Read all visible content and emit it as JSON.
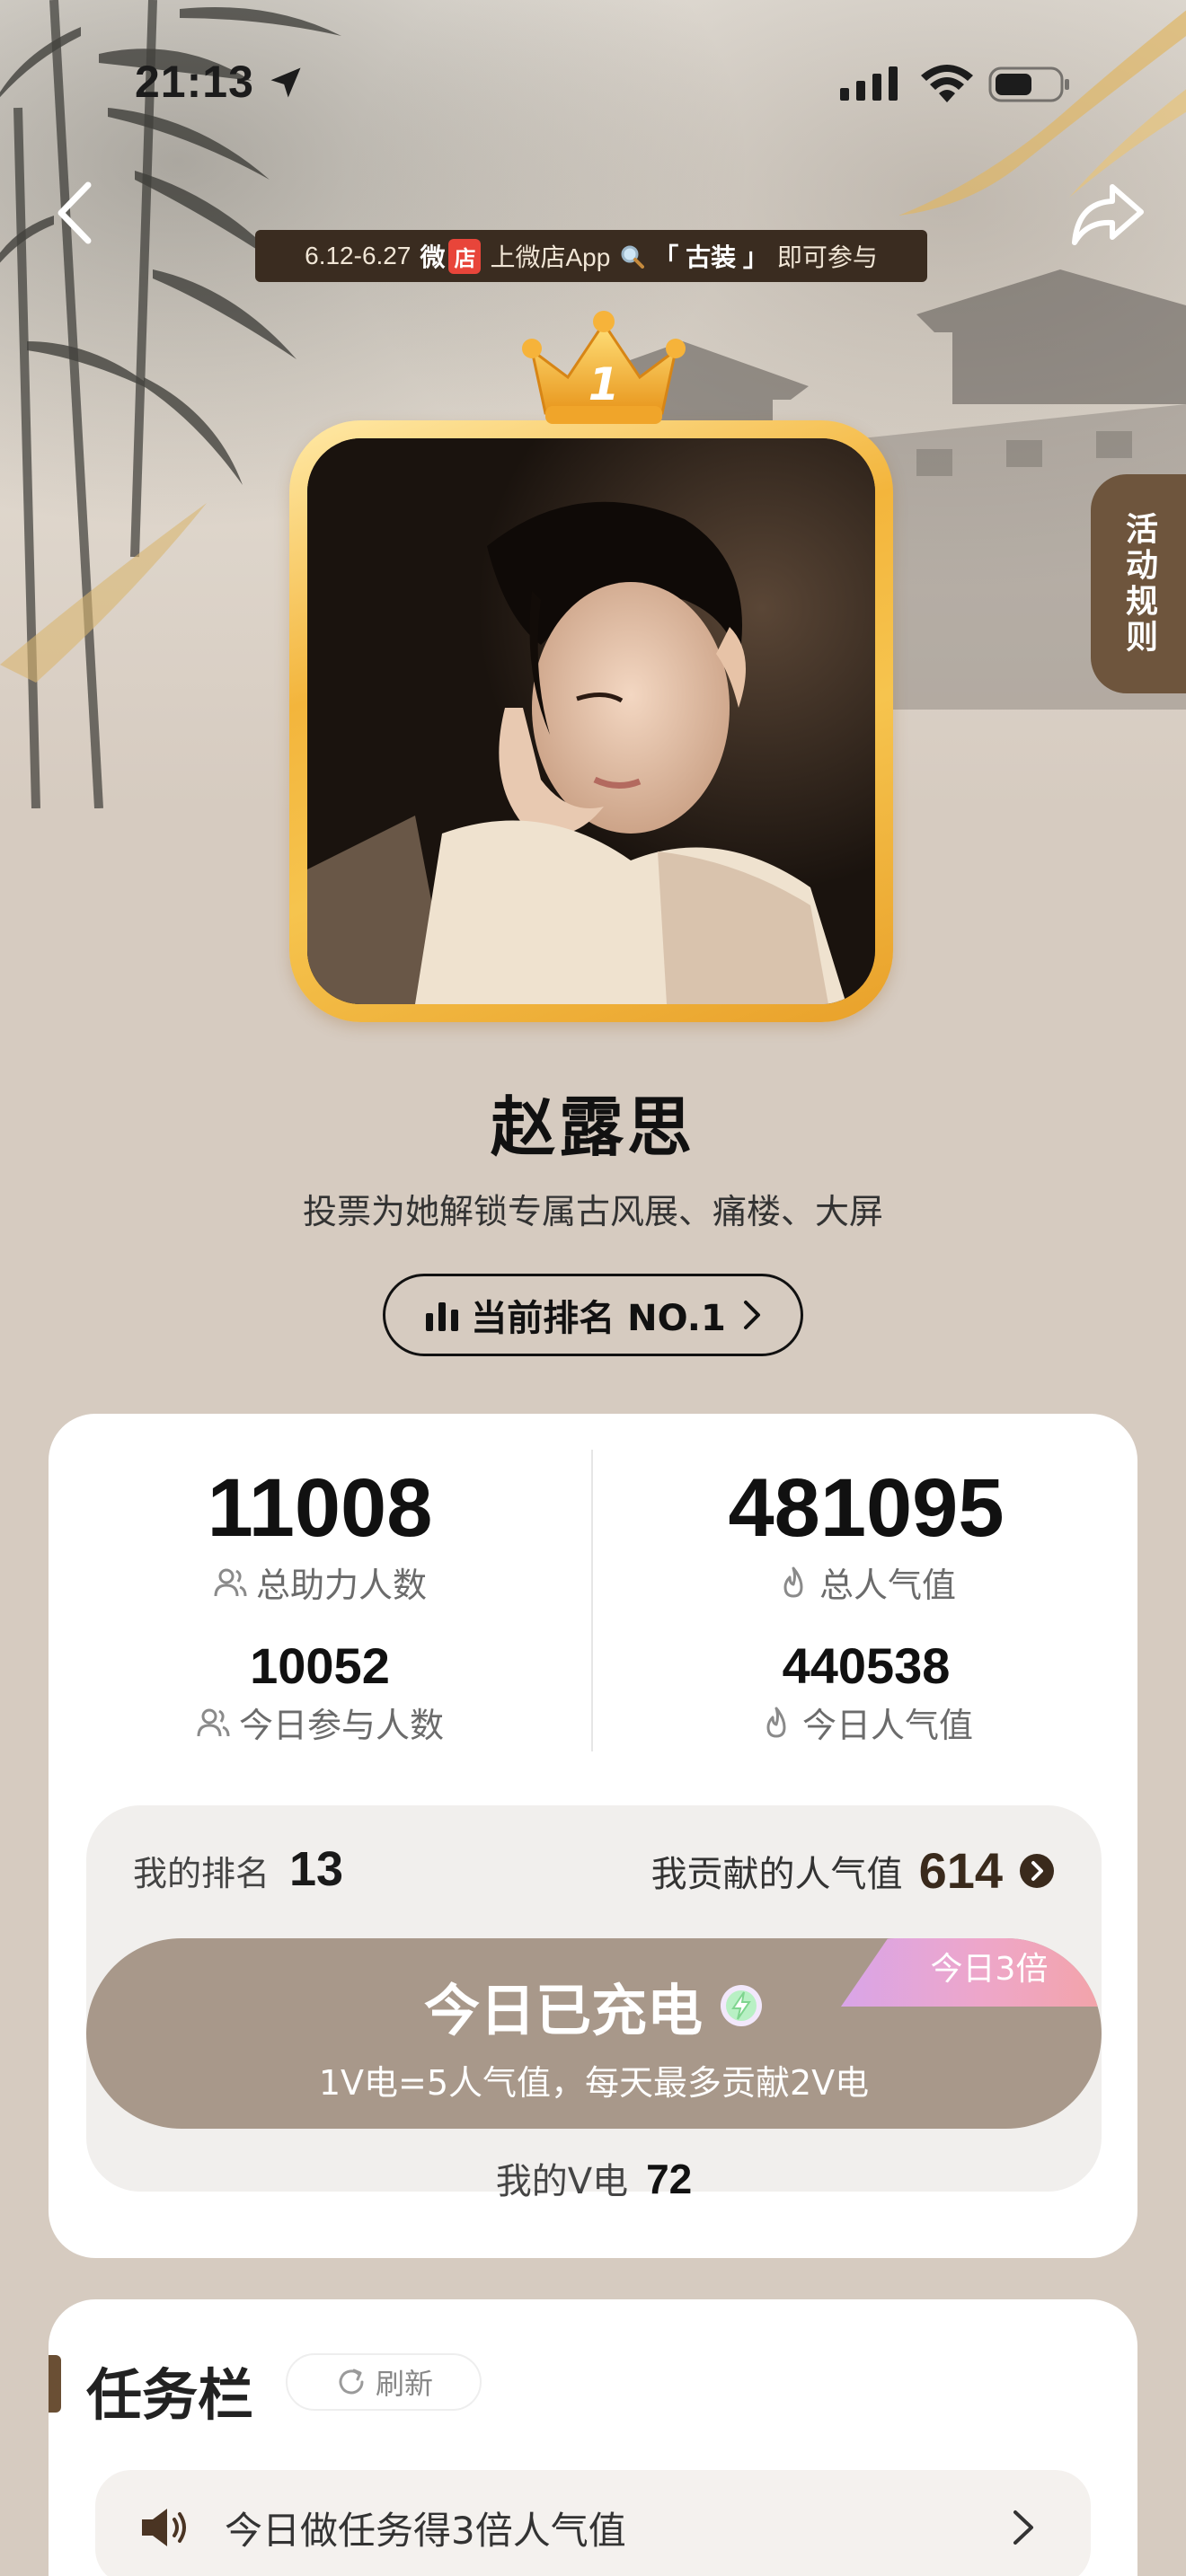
{
  "status_bar": {
    "time": "21:13"
  },
  "promo": {
    "dates": "6.12-6.27",
    "brand_wei": "微",
    "brand_dian": "店",
    "text1": "上微店App",
    "keyword": "「 古装 」",
    "text2": "即可参与"
  },
  "rules_tab": {
    "label": "活动规则"
  },
  "crown": {
    "rank": "1"
  },
  "profile": {
    "name": "赵露思",
    "subtitle": "投票为她解锁专属古风展、痛楼、大屏",
    "rank_label": "当前排名 NO.1"
  },
  "stats": {
    "total_supporters": {
      "value": "11008",
      "label": "总助力人数"
    },
    "total_popularity": {
      "value": "481095",
      "label": "总人气值"
    },
    "today_participants": {
      "value": "10052",
      "label": "今日参与人数"
    },
    "today_popularity": {
      "value": "440538",
      "label": "今日人气值"
    }
  },
  "my": {
    "rank_label": "我的排名",
    "rank_value": "13",
    "contrib_label": "我贡献的人气值",
    "contrib_value": "614",
    "charge_title": "今日已充电",
    "charge_desc": "1V电=5人气值，每天最多贡献2V电",
    "multiplier": "今日3倍",
    "v_label": "我的V电",
    "v_value": "72"
  },
  "tasks": {
    "title": "任务栏",
    "refresh_label": "刷新",
    "row_text": "今日做任务得3倍人气值"
  },
  "colors": {
    "accent_brown": "#6e553d",
    "charge_bg": "#a8988a",
    "gold": "#f3b53c",
    "page_bg": "#d6cbc0"
  },
  "icons": [
    "location-arrow-icon",
    "signal-icon",
    "wifi-icon",
    "battery-icon",
    "back-icon",
    "share-icon",
    "crown-icon",
    "bar-chart-icon",
    "chevron-right-icon",
    "users-icon",
    "flame-icon",
    "arrow-circle-icon",
    "lightning-icon",
    "refresh-icon",
    "speaker-icon"
  ]
}
